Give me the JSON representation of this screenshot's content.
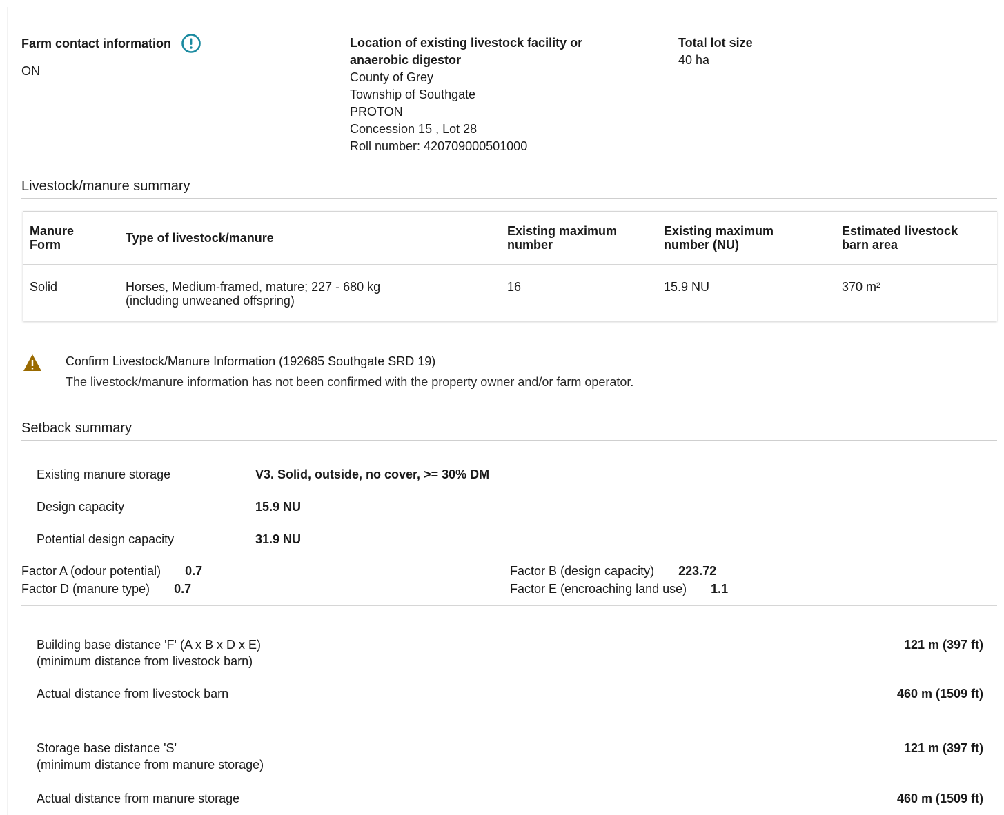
{
  "farm": {
    "contact_label": "Farm contact information",
    "contact_value": "ON",
    "alert_icon": "alert-circle-icon",
    "alert_color": "#1a8aa0"
  },
  "location": {
    "label_line1": "Location of existing livestock facility or",
    "label_line2": "anaerobic digestor",
    "county": "County of Grey",
    "township": "Township of Southgate",
    "community": "PROTON",
    "concession_lot": "Concession 15 , Lot 28",
    "roll_number": "Roll number: 420709000501000"
  },
  "lot": {
    "label": "Total lot size",
    "value": "40 ha"
  },
  "livestock_summary": {
    "title": "Livestock/manure summary",
    "headers": [
      [
        "Manure",
        "Form"
      ],
      [
        "Type of livestock/manure"
      ],
      [
        "Existing maximum",
        "number"
      ],
      [
        "Existing maximum",
        "number (NU)"
      ],
      [
        "Estimated livestock",
        "barn area"
      ]
    ],
    "rows": [
      {
        "form": "Solid",
        "type_line1": "Horses, Medium-framed, mature; 227 - 680 kg",
        "type_line2": "(including unweaned offspring)",
        "max_number": "16",
        "max_nu": "15.9 NU",
        "barn_area": "370 m²"
      }
    ]
  },
  "warning": {
    "icon": "warning-triangle-icon",
    "icon_color": "#9a6a00",
    "title": "Confirm Livestock/Manure Information (192685 Southgate SRD 19)",
    "text": "The livestock/manure information has not been confirmed with the property owner and/or farm operator."
  },
  "setback": {
    "title": "Setback summary",
    "existing_storage_label": "Existing manure storage",
    "existing_storage_value": "V3. Solid, outside, no cover, >= 30% DM",
    "design_capacity_label": "Design capacity",
    "design_capacity_value": "15.9 NU",
    "potential_capacity_label": "Potential design capacity",
    "potential_capacity_value": "31.9 NU",
    "factor_a_label": "Factor A (odour potential)",
    "factor_a_value": "0.7",
    "factor_b_label": "Factor B (design capacity)",
    "factor_b_value": "223.72",
    "factor_d_label": "Factor D (manure type)",
    "factor_d_value": "0.7",
    "factor_e_label": "Factor E (encroaching land use)",
    "factor_e_value": "1.1",
    "building_base_line1": "Building base distance 'F' (A x B x D x E)",
    "building_base_line2": "(minimum distance from livestock barn)",
    "building_base_value": "121 m (397 ft)",
    "actual_barn_label": "Actual distance from livestock barn",
    "actual_barn_value": "460 m (1509 ft)",
    "storage_base_line1": "Storage base distance 'S'",
    "storage_base_line2": "(minimum distance from manure storage)",
    "storage_base_value": "121 m (397 ft)",
    "actual_storage_label": "Actual distance from manure storage",
    "actual_storage_value": "460 m (1509 ft)"
  }
}
